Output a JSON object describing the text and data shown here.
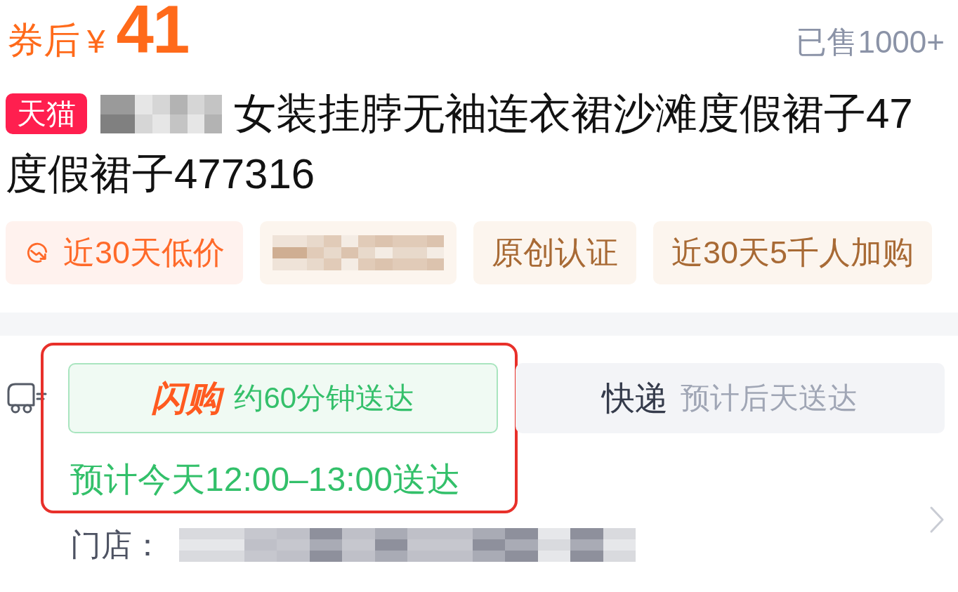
{
  "price": {
    "prefix": "券后",
    "currency": "¥",
    "amount": "41"
  },
  "sold": "已售1000+",
  "title": {
    "badge": "天猫",
    "lines": [
      "女装挂脖无袖连衣裙沙滩度假裙子47",
      "度假裙子477316"
    ]
  },
  "tags": [
    {
      "kind": "low-price",
      "label": "近30天低价"
    },
    {
      "kind": "redacted"
    },
    {
      "kind": "plain",
      "label": "原创认证"
    },
    {
      "kind": "plain",
      "label": "近30天5千人加购"
    }
  ],
  "delivery": {
    "highlighted": true,
    "options": [
      {
        "kind": "flash",
        "logo": "闪购",
        "label": "约60分钟送达",
        "selected": true
      },
      {
        "kind": "express",
        "name": "快递",
        "label": "预计后天送达",
        "selected": false
      }
    ],
    "estimate": "预计今天12:00–13:00送达",
    "store_label": "门店："
  }
}
